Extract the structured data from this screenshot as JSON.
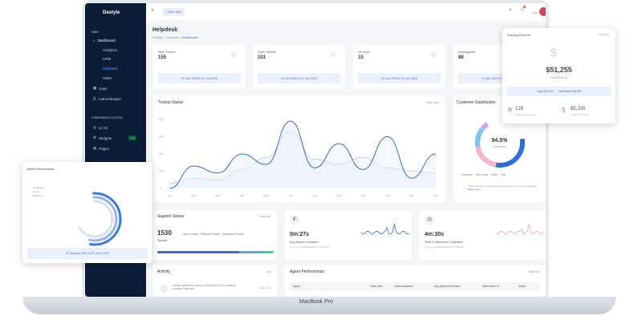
{
  "device_label": "MacBook Pro",
  "topbar": {
    "new_task": "+ New Task",
    "user": "Nick",
    "notification_count": "1"
  },
  "sidebar": {
    "brand": "Dastyle",
    "section_main": "MAIN",
    "dashboard": "Dashboard",
    "sub": [
      "Analytics",
      "CRM",
      "Helpdesk",
      "Sales"
    ],
    "apps": "Apps",
    "auth": "Authentication",
    "section_components": "COMPONENTS & EXTRA",
    "ui_kit": "UI Kit",
    "widgets": "Widgets",
    "widgets_badge": "New",
    "pages": "Pages"
  },
  "page": {
    "title": "Helpdesk",
    "breadcrumb": [
      "Dastyle",
      "Helpdesk",
      "Dashboard"
    ]
  },
  "stats": [
    {
      "label": "New Tickets",
      "value": "155",
      "range": "01 Jan 2020 to 31 Jun 2020",
      "icon": "tag-icon"
    },
    {
      "label": "Open Tickets",
      "value": "101",
      "range": "01 Jan 2020 to 31 Jun 2020",
      "icon": "box-icon"
    },
    {
      "label": "On Hold",
      "value": "15",
      "range": "01 Jan 2020 to 31 Jun 2020",
      "icon": "bolt-icon"
    },
    {
      "label": "Unassigned",
      "value": "88",
      "range": "01 Jan 2020 to 31 Jun 2020",
      "icon": "user-icon"
    }
  ],
  "chart_data": {
    "type": "area",
    "title": "Tickets Status",
    "filter": "This Year",
    "categories": [
      "Jan",
      "Feb",
      "Mar",
      "Apr",
      "May",
      "Jun",
      "Jul",
      "Aug",
      "Sep",
      "Oct",
      "Nov",
      "Dec"
    ],
    "yticks": [
      0,
      100,
      200,
      300,
      400
    ],
    "ylim": [
      0,
      400
    ],
    "series": [
      {
        "values": [
          0,
          130,
          90,
          200,
          140,
          390,
          120,
          260,
          110,
          300,
          60,
          200
        ],
        "color": "#3b6bc4"
      },
      {
        "values": [
          30,
          60,
          50,
          110,
          180,
          330,
          170,
          140,
          180,
          120,
          100,
          90
        ],
        "color": "#b7c6e4"
      }
    ]
  },
  "satisfaction": {
    "title": "Customer Satisfaction",
    "value": "94.5%",
    "label": "HAPPINESS",
    "legend": [
      "Excellent",
      "Very Good",
      "Good",
      "Fair"
    ],
    "note": "There are many variations of passages of Lorem Ipsum available...",
    "read_more": "Read more"
  },
  "support": {
    "title": "Support Status",
    "view_all": "View All",
    "count": "1530",
    "unit": "Tickets",
    "legend": [
      "Open Tickets",
      "Resolved Tickets",
      "Unresolved Tickets"
    ],
    "bar": [
      70,
      20,
      10
    ]
  },
  "metrics": [
    {
      "value": "0m:27s",
      "label": "Avg.Speed of answer",
      "sub": "It is a long established fact that a reader",
      "icon": "phone-icon",
      "color": "#3b6bc4"
    },
    {
      "value": "4m:30s",
      "label": "Time to Resolved Complaint",
      "sub": "It is a long established fact that a reader",
      "icon": "clock-icon",
      "color": "#e7a1b4"
    }
  ],
  "activity": {
    "title": "Activity",
    "filter": "All",
    "text": "Donald updated the status of Refund #1234 to awaiting customer response",
    "time": "10 Min ago"
  },
  "agent": {
    "title": "Agent Performance",
    "view_all": "View All",
    "columns": [
      "Agent",
      "Total Calls",
      "Calls Answered",
      "Avg.Speed of answer",
      "Adherence %",
      "Action"
    ]
  },
  "earning": {
    "title": "Earning Reports",
    "filter": "This Week",
    "total": "$51,255",
    "total_label": "Total Revenue",
    "target": "Target $20,000",
    "last_month": "Last Month $18,250",
    "orders": "128",
    "orders_label": "Today's New Order",
    "revenue": "$5,335",
    "revenue_label": "Today's Revenue"
  },
  "tasks": {
    "title": "Tasks Performance",
    "legend": [
      "Completed",
      "Active",
      "Assigned"
    ],
    "range": "01 January 2020 to 31 June 2020"
  }
}
